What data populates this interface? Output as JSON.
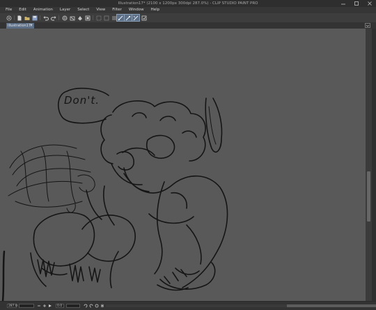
{
  "window": {
    "title": "Illustration17* (2100 x 1200px 300dpi 287.0%) - CLIP STUDIO PAINT PRO",
    "controls": [
      "minimize",
      "maximize",
      "close"
    ]
  },
  "menu": {
    "items": [
      "File",
      "Edit",
      "Animation",
      "Layer",
      "Select",
      "View",
      "Filter",
      "Window",
      "Help"
    ]
  },
  "toolbar": {
    "icons": [
      "app-menu-icon",
      "new-file-icon",
      "open-folder-icon",
      "save-icon",
      "undo-icon",
      "redo-icon",
      "transform-icon",
      "clear-icon",
      "fill-icon",
      "crop-icon",
      "select-all-icon",
      "deselect-icon",
      "invert-selection-icon",
      "snap-ruler-icon",
      "snap-grid-icon",
      "snap-special-icon",
      "settings-icon"
    ]
  },
  "tabs": [
    {
      "label": "Illustration17*",
      "close": "×",
      "active": true
    }
  ],
  "canvas": {
    "background": "#595959",
    "speech_text": "Don't."
  },
  "statusbar": {
    "zoom": "287.0",
    "angle": "0.0"
  },
  "colors": {
    "titlebar": "#2e2e2e",
    "menubar": "#363636",
    "toolbar": "#3d3d3d",
    "accent": "#5c6f86",
    "canvas": "#595959",
    "ink": "#141414"
  }
}
